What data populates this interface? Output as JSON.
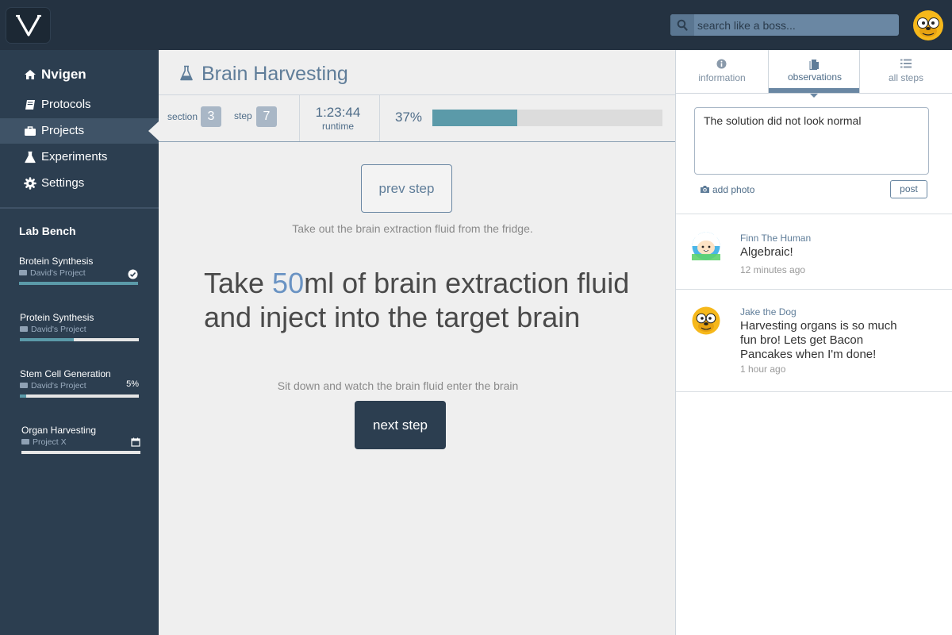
{
  "app": {
    "logo_text": "V",
    "search_placeholder": "search like a boss..."
  },
  "sidebar": {
    "brand": "Nvigen",
    "items": [
      {
        "label": "Protocols",
        "icon": "book-icon"
      },
      {
        "label": "Projects",
        "icon": "briefcase-icon",
        "active": true
      },
      {
        "label": "Experiments",
        "icon": "flask-icon"
      },
      {
        "label": "Settings",
        "icon": "gear-icon"
      }
    ],
    "bench_title": "Lab Bench",
    "bench": [
      {
        "name": "Brotein Synthesis",
        "project": "David's Project",
        "status": "check-circle-icon",
        "progress": 1.0
      },
      {
        "name": "Protein Synthesis",
        "project": "David's Project",
        "status": "",
        "progress": 0.45
      },
      {
        "name": "Stem Cell Generation",
        "project": "David's Project",
        "status": "5%",
        "progress": 0.05
      },
      {
        "name": "Organ Harvesting",
        "project": "Project X",
        "status": "calendar-icon",
        "progress": 0.0
      }
    ]
  },
  "main": {
    "title": "Brain Harvesting",
    "section_label": "section",
    "section_value": "3",
    "step_label": "step",
    "step_value": "7",
    "runtime_value": "1:23:44",
    "runtime_label": "runtime",
    "progress_text": "37%",
    "progress": 0.37,
    "prev_button": "prev step",
    "prev_description": "Take out the brain extraction fluid from the fridge.",
    "instruction_pre": "Take ",
    "instruction_highlight": "50",
    "instruction_post": "ml of brain extraction fluid and inject into the target brain",
    "next_description": "Sit down and watch the brain fluid enter the brain",
    "next_button": "next step"
  },
  "panel": {
    "tabs": [
      {
        "label": "information",
        "icon": "info-icon"
      },
      {
        "label": "observations",
        "icon": "document-icon",
        "active": true
      },
      {
        "label": "all steps",
        "icon": "list-icon"
      }
    ],
    "observation_value": "The solution did not look normal",
    "add_photo": "add photo",
    "post_button": "post",
    "comments": [
      {
        "author": "Finn The Human",
        "text": "Algebraic!",
        "time": "12 minutes ago"
      },
      {
        "author": "Jake the Dog",
        "text": "Harvesting organs is so much fun bro! Lets get Bacon Pancakes when I'm done!",
        "time": "1 hour ago"
      }
    ]
  },
  "colors": {
    "navy": "#2c3e50",
    "topbar": "#243241",
    "accent": "#5b9aa9",
    "slate_blue": "#5f7d99"
  }
}
